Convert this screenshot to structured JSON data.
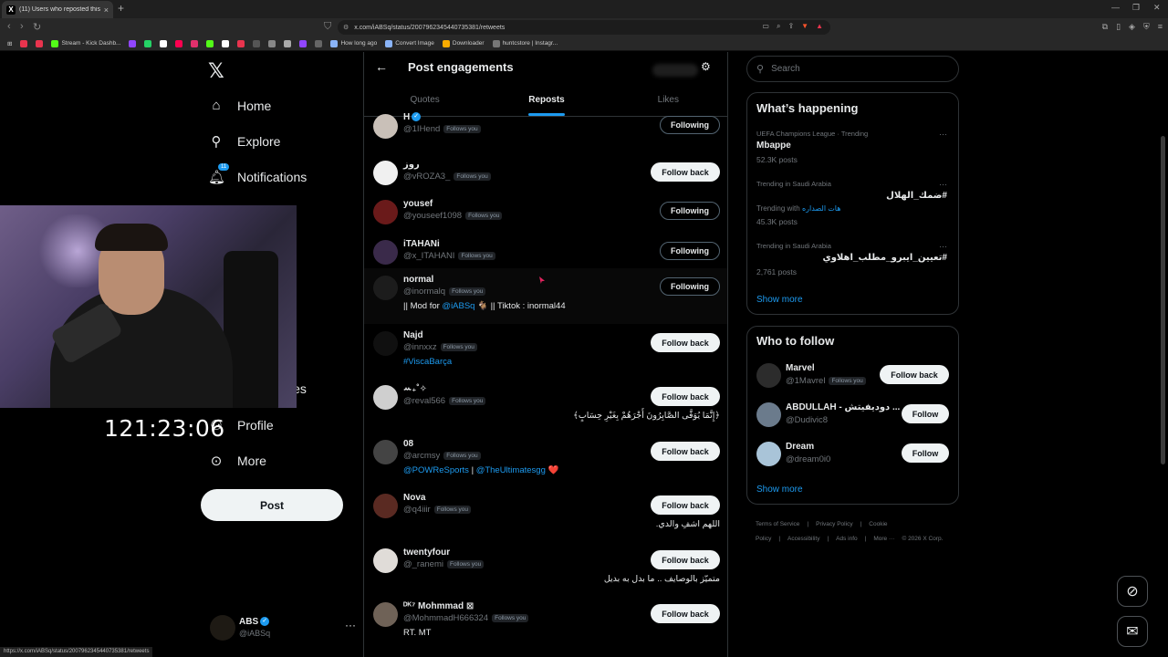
{
  "browser": {
    "tab_title": "(11) Users who reposted this po...",
    "tab_close": "×",
    "new_tab": "+",
    "url": "x.com/iABSq/status/2007962345440735381/retweets",
    "status_url": "https://x.com/iABSq/status/2007962345440735381/retweets",
    "bookmarks": [
      {
        "label": "",
        "color": "#e8344e"
      },
      {
        "label": "",
        "color": "#e8344e"
      },
      {
        "label": "Stream - Kick Dashb...",
        "color": "#53fc18"
      },
      {
        "label": "",
        "color": "#9146ff"
      },
      {
        "label": "",
        "color": "#25d366"
      },
      {
        "label": "",
        "color": "#ffffff"
      },
      {
        "label": "",
        "color": "#ff0050"
      },
      {
        "label": "",
        "color": "#e1306c"
      },
      {
        "label": "",
        "color": "#53fc18"
      },
      {
        "label": "",
        "color": "#ffffff"
      },
      {
        "label": "",
        "color": "#e8344e"
      },
      {
        "label": "",
        "color": "#555555"
      },
      {
        "label": "",
        "color": "#888888"
      },
      {
        "label": "",
        "color": "#aaaaaa"
      },
      {
        "label": "",
        "color": "#9146ff"
      },
      {
        "label": "",
        "color": "#666666"
      },
      {
        "label": "How long ago",
        "color": "#8ab4f8"
      },
      {
        "label": "Convert Image",
        "color": "#8ab4f8"
      },
      {
        "label": "Downloader",
        "color": "#f9ab00"
      },
      {
        "label": "huntcstore | Instagr...",
        "color": "#777777"
      }
    ]
  },
  "nav": {
    "items": [
      {
        "label": "Home",
        "icon": "home-icon"
      },
      {
        "label": "Explore",
        "icon": "search-icon"
      },
      {
        "label": "Notifications",
        "icon": "bell-icon",
        "badge": "11"
      },
      {
        "label": "Profile",
        "icon": "person-icon"
      },
      {
        "label": "More",
        "icon": "more-circle-icon"
      }
    ],
    "partial_1": "s",
    "partial_2": "ies",
    "post_label": "Post",
    "account": {
      "name": "ABS",
      "handle": "@iABSq"
    }
  },
  "stream": {
    "timer": "121:23:06"
  },
  "engagements": {
    "title": "Post engagements",
    "tabs": [
      "Quotes",
      "Reposts",
      "Likes"
    ],
    "active_tab": "Reposts",
    "follows_you": "Follows you",
    "users": [
      {
        "name": "H",
        "verified": true,
        "handle": "@1IHend",
        "button": "Following",
        "bio": ""
      },
      {
        "name": "روز",
        "verified": false,
        "handle": "@vROZA3_",
        "button": "Follow back",
        "bio": ""
      },
      {
        "name": "yousef",
        "verified": false,
        "handle": "@youseef1098",
        "button": "Following",
        "bio": ""
      },
      {
        "name": "iTAHANi",
        "verified": false,
        "handle": "@x_ITAHANI",
        "button": "Following",
        "bio": ""
      },
      {
        "name": "normal",
        "verified": false,
        "handle": "@inormalq",
        "button": "Following",
        "bio_prefix": "|| Mod for ",
        "bio_link": "@iABSq",
        "bio_suffix": " 🐐 || Tiktok : inormal44"
      },
      {
        "name": "Najd",
        "verified": false,
        "handle": "@innxxz",
        "button": "Follow back",
        "bio_link": "#ViscaBarça"
      },
      {
        "name": "ꕀ₊˚✧",
        "verified": false,
        "handle": "@reval566",
        "button": "Follow back",
        "bio_rtl": "﴿إِنَّمَا يُوَفَّى الصَّابِرُونَ أَجْرَهُمْ بِغَيْرِ حِسَابٍ﴾"
      },
      {
        "name": "08",
        "verified": false,
        "handle": "@arcmsy",
        "button": "Follow back",
        "bio_link": "@POWReSports",
        "bio_sep": " | ",
        "bio_link2": "@TheUltimatesgg",
        "bio_heart": "❤️"
      },
      {
        "name": "Nova",
        "verified": false,
        "handle": "@q4iiir",
        "button": "Follow back",
        "bio_rtl": "اللهم اشفِ والدي."
      },
      {
        "name": "twentyfour",
        "verified": false,
        "handle": "@_ranemi",
        "button": "Follow back",
        "bio_rtl": "متميّز بالوصايف .. ما بدل به بديل"
      },
      {
        "name": "ᴰᴷ⁷ Mohmmad ⊠",
        "verified": false,
        "handle": "@MohmmadH666324",
        "button": "Follow back",
        "bio": "RT. MT"
      }
    ]
  },
  "sidebar": {
    "search_placeholder": "Search",
    "whats_happening": {
      "title": "What’s happening",
      "trends": [
        {
          "meta": "UEFA Champions League · Trending",
          "name": "Mbappe",
          "count": "52.3K posts"
        },
        {
          "meta": "Trending in Saudi Arabia",
          "name": "#ضمك_الهلال",
          "with_label": "Trending with",
          "with_link": "هات الصداره",
          "count": "45.3K posts"
        },
        {
          "meta": "Trending in Saudi Arabia",
          "name": "#تعيين_ايبرو_مطلب_اهلاوي",
          "count": "2,761 posts"
        }
      ],
      "show_more": "Show more"
    },
    "who_to_follow": {
      "title": "Who to follow",
      "accounts": [
        {
          "name": "Marvel",
          "handle": "@1Mavrel",
          "follows_you": "Follows you",
          "button": "Follow back"
        },
        {
          "name": "ABDULLAH - دوديفيتش ...",
          "handle": "@Dudivic8",
          "button": "Follow"
        },
        {
          "name": "Dream",
          "handle": "@dream0i0",
          "button": "Follow"
        }
      ],
      "show_more": "Show more"
    },
    "footer": [
      "Terms of Service",
      "|",
      "Privacy Policy",
      "|",
      "Cookie Policy",
      "|",
      "Accessibility",
      "|",
      "Ads info",
      "|",
      "More ···",
      "© 2026 X Corp."
    ]
  }
}
